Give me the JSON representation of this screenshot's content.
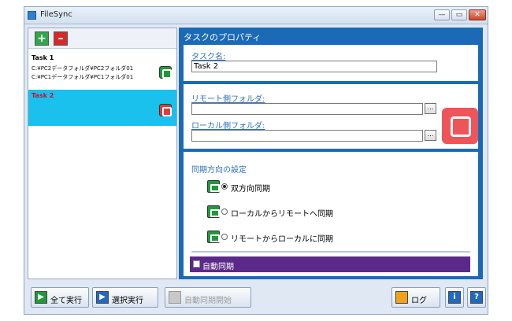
{
  "window": {
    "title": "FileSync",
    "minimize": "—",
    "maximize": "▭",
    "close": "✕"
  },
  "toolbar": {
    "add_glyph": "+",
    "delete_glyph": "–"
  },
  "tasks": [
    {
      "name": "Task 1",
      "remote": "C:¥PC2データフォルダ¥PC2フォルダ01",
      "local": "C:¥PC1データフォルダ¥PC1フォルダ01",
      "status_color": "#1f9a3b"
    },
    {
      "name": "Task 2",
      "status_color": "#e23b3b"
    }
  ],
  "properties": {
    "header": "タスクのプロパティ",
    "task_name_label": "タスク名:",
    "task_name_value": "Task 2",
    "remote_label": "リモート側フォルダ:",
    "remote_value": "",
    "local_label": "ローカル側フォルダ:",
    "local_value": "",
    "browse_label": "...",
    "sync_section_title": "同期方向の設定",
    "options": [
      {
        "label": "双方向同期",
        "selected": true
      },
      {
        "label": "ローカルからリモートへ同期",
        "selected": false
      },
      {
        "label": "リモートからローカルに同期",
        "selected": false
      }
    ],
    "auto_sync_label": "自動同期"
  },
  "bottom": {
    "run_all": "全て実行",
    "run_selected": "選択実行",
    "auto_start": "自動同期開始",
    "log": "ログ",
    "info_glyph": "i",
    "help_glyph": "?"
  },
  "colors": {
    "accent_blue": "#1b6ab5",
    "selected_row": "#19c1ec",
    "auto_bar": "#5b2a88"
  }
}
